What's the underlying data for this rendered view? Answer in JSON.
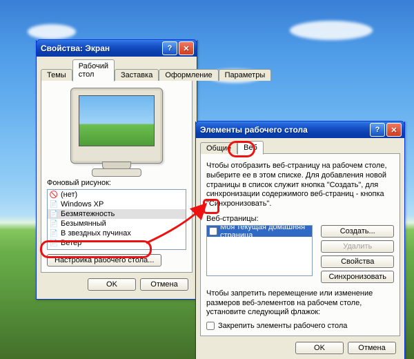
{
  "dialog1": {
    "title": "Свойства: Экран",
    "tabs": [
      "Темы",
      "Рабочий стол",
      "Заставка",
      "Оформление",
      "Параметры"
    ],
    "active_tab_index": 1,
    "bg_label": "Фоновый рисунок:",
    "bg_items": [
      {
        "icon": "none-icon",
        "label": "(нет)"
      },
      {
        "icon": "file-icon",
        "label": "Windows XP"
      },
      {
        "icon": "file-icon",
        "label": "Безмятежность"
      },
      {
        "icon": "file-icon",
        "label": "Безымянный"
      },
      {
        "icon": "file-icon",
        "label": "В звездных пучинах"
      },
      {
        "icon": "file-icon",
        "label": "Ветер"
      }
    ],
    "selected_bg_index": 2,
    "customize_btn": "Настройка рабочего стола...",
    "ok": "OK",
    "cancel": "Отмена"
  },
  "dialog2": {
    "title": "Элементы рабочего стола",
    "tabs": [
      "Общие",
      "Веб"
    ],
    "active_tab_index": 1,
    "intro": "Чтобы отобразить веб-страницу на рабочем столе, выберите ее в этом списке. Для добавления новой страницы в список служит кнопка \"Создать\", для синхронизации содержимого веб-страниц - кнопка \"Синхронизовать\".",
    "webpages_label": "Веб-страницы:",
    "web_items": [
      {
        "checked": false,
        "label": "Моя текущая домашняя страница"
      }
    ],
    "selected_web_index": 0,
    "btn_new": "Создать...",
    "btn_delete": "Удалить",
    "btn_props": "Свойства",
    "btn_sync": "Синхронизовать",
    "lock_intro": "Чтобы запретить перемещение или изменение размеров веб-элементов на рабочем столе, установите следующий флажок:",
    "lock_checkbox": "Закрепить элементы рабочего стола",
    "ok": "OK",
    "cancel": "Отмена"
  }
}
